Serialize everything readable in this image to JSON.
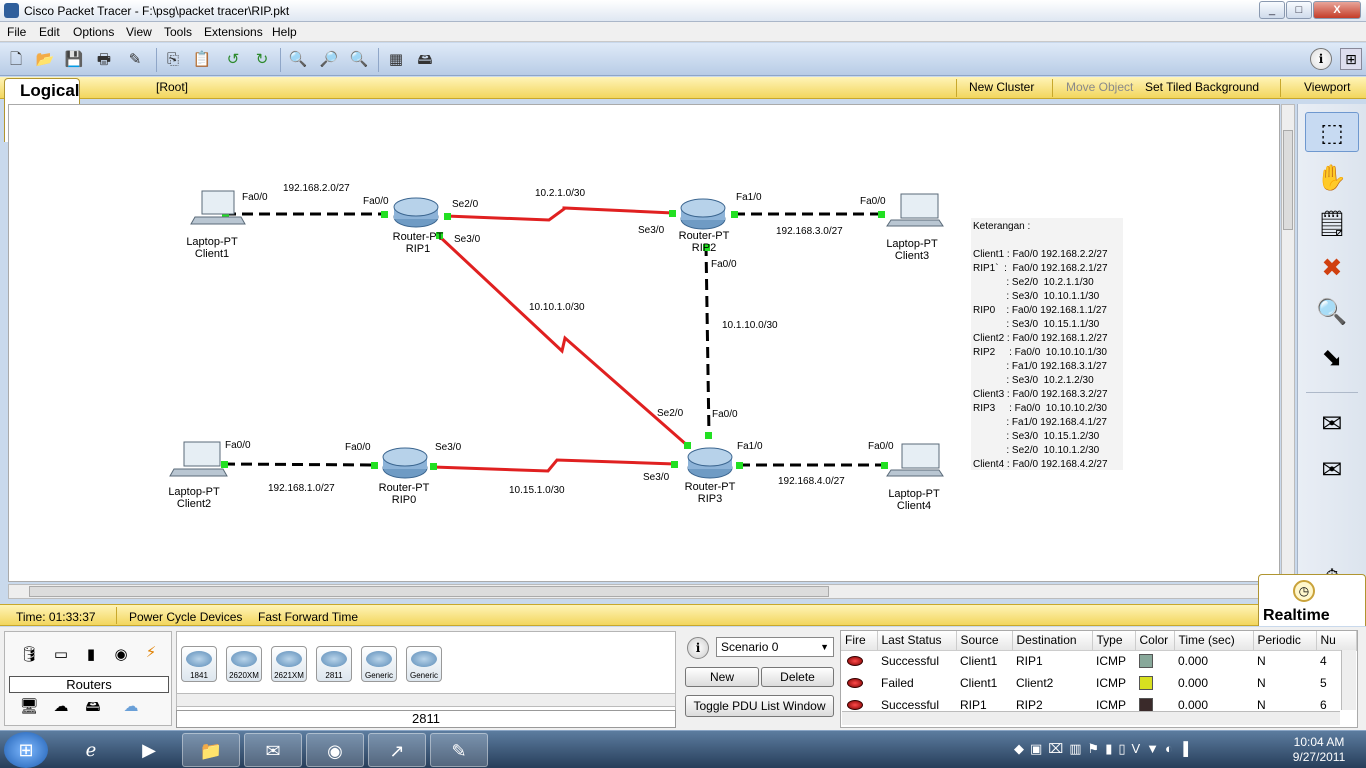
{
  "window": {
    "title": "Cisco Packet Tracer - F:\\psg\\packet tracer\\RIP.pkt",
    "min": "_",
    "max": "□",
    "close": "X"
  },
  "menu": [
    "File",
    "Edit",
    "Options",
    "View",
    "Tools",
    "Extensions",
    "Help"
  ],
  "toolbar": {
    "icons": [
      "new-icon",
      "open-icon",
      "save-icon",
      "print-icon",
      "activity-wizard-icon",
      "copy-icon",
      "paste-icon",
      "undo-icon",
      "redo-icon",
      "zoom-in-icon",
      "zoom-reset-icon",
      "zoom-out-icon",
      "palette-icon",
      "custom-device-icon"
    ],
    "help": "i"
  },
  "logical_bar": {
    "tab": "Logical",
    "root": "[Root]",
    "new_cluster": "New Cluster",
    "move_object": "Move Object",
    "set_tiled_background": "Set Tiled Background",
    "viewport": "Viewport"
  },
  "topology": {
    "devices": {
      "client1": {
        "type": "Laptop-PT",
        "name": "Client1"
      },
      "client2": {
        "type": "Laptop-PT",
        "name": "Client2"
      },
      "client3": {
        "type": "Laptop-PT",
        "name": "Client3"
      },
      "client4": {
        "type": "Laptop-PT",
        "name": "Client4"
      },
      "rip0": {
        "type": "Router-PT",
        "name": "RIP0"
      },
      "rip1": {
        "type": "Router-PT",
        "name": "RIP1"
      },
      "rip2": {
        "type": "Router-PT",
        "name": "RIP2"
      },
      "rip3": {
        "type": "Router-PT",
        "name": "RIP3"
      }
    },
    "networks": {
      "n1": "192.168.2.0/27",
      "n2": "10.2.1.0/30",
      "n3": "192.168.3.0/27",
      "n4": "10.10.1.0/30",
      "n5": "10.1.10.0/30",
      "n6": "192.168.1.0/27",
      "n7": "10.15.1.0/30",
      "n8": "192.168.4.0/27"
    },
    "ports": {
      "c1_fa00": "Fa0/0",
      "r1_fa00": "Fa0/0",
      "r1_se20": "Se2/0",
      "r1_se30": "Se3/0",
      "r2_se30": "Se3/0",
      "r2_fa10": "Fa1/0",
      "r2_fa00": "Fa0/0",
      "c3_fa00": "Fa0/0",
      "c2_fa00": "Fa0/0",
      "r0_fa00": "Fa0/0",
      "r0_se30": "Se3/0",
      "r3_se20": "Se2/0",
      "r3_fa00": "Fa0/0",
      "r3_se30": "Se3/0",
      "r3_fa10": "Fa1/0",
      "c4_fa00": "Fa0/0"
    }
  },
  "legend": {
    "title": "Keterangan :",
    "lines": [
      "Client1 : Fa0/0 192.168.2.2/27",
      "RIP1`  :  Fa0/0 192.168.2.1/27",
      "            : Se2/0  10.2.1.1/30",
      "            : Se3/0  10.10.1.1/30",
      "RIP0    : Fa0/0 192.168.1.1/27",
      "            : Se3/0  10.15.1.1/30",
      "Client2 : Fa0/0 192.168.1.2/27",
      "RIP2     : Fa0/0  10.10.10.1/30",
      "            : Fa1/0 192.168.3.1/27",
      "            : Se3/0  10.2.1.2/30",
      "Client3 : Fa0/0 192.168.3.2/27",
      "RIP3     : Fa0/0  10.10.10.2/30",
      "            : Fa1/0 192.168.4.1/27",
      "            : Se3/0  10.15.1.2/30",
      "            : Se2/0  10.10.1.2/30",
      "Client4 : Fa0/0 192.168.4.2/27"
    ]
  },
  "status_bar": {
    "time": "Time: 01:33:37",
    "power_cycle": "Power Cycle Devices",
    "fast_forward": "Fast Forward Time",
    "realtime": "Realtime"
  },
  "device_panel": {
    "category": "Routers",
    "models": [
      "1841",
      "2620XM",
      "2621XM",
      "2811",
      "Generic",
      "Generic"
    ],
    "selected_model": "2811"
  },
  "scenario": {
    "info": "i",
    "selected": "Scenario 0",
    "new": "New",
    "delete": "Delete",
    "toggle": "Toggle PDU List Window"
  },
  "pdu_table": {
    "headers": [
      "Fire",
      "Last Status",
      "Source",
      "Destination",
      "Type",
      "Color",
      "Time (sec)",
      "Periodic",
      "Nu"
    ],
    "rows": [
      {
        "status": "Successful",
        "source": "Client1",
        "destination": "RIP1",
        "type": "ICMP",
        "color": "#88a89a",
        "time": "0.000",
        "periodic": "N",
        "num": "4"
      },
      {
        "status": "Failed",
        "source": "Client1",
        "destination": "Client2",
        "type": "ICMP",
        "color": "#d8e020",
        "time": "0.000",
        "periodic": "N",
        "num": "5"
      },
      {
        "status": "Successful",
        "source": "RIP1",
        "destination": "RIP2",
        "type": "ICMP",
        "color": "#3a2a2a",
        "time": "0.000",
        "periodic": "N",
        "num": "6"
      }
    ]
  },
  "taskbar": {
    "clock_time": "10:04 AM",
    "clock_date": "9/27/2011"
  }
}
